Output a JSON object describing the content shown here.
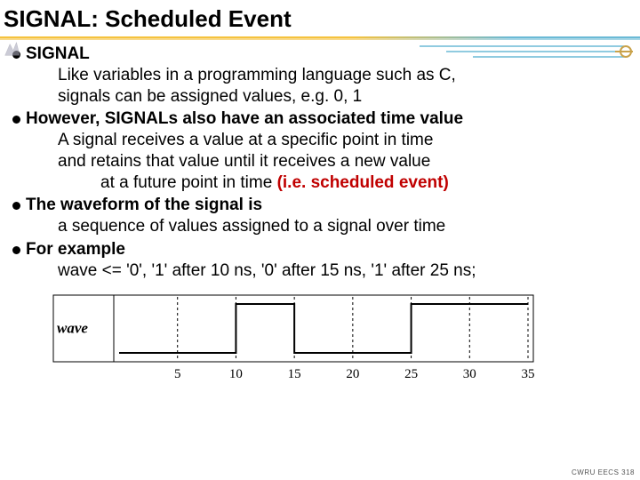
{
  "title": "SIGNAL: Scheduled Event",
  "bullets": [
    {
      "head": "SIGNAL",
      "subs": [
        "Like variables in a programming language such as C,",
        "signals can be assigned values, e.g. 0, 1"
      ]
    },
    {
      "head": "However, SIGNALs also have an associated time value",
      "subs": [
        "A signal receives a value at a specific point in time",
        "and retains that value until it receives a new value"
      ],
      "sub_extra": "at a future point in time ",
      "sub_extra_em": "(i.e. scheduled event)"
    },
    {
      "head": "The waveform of the signal is",
      "subs": [
        "a sequence of values assigned to a signal over time"
      ]
    },
    {
      "head": "For example",
      "subs": [
        "wave <= '0', '1' after 10 ns, '0' after 15 ns, '1' after 25 ns;"
      ]
    }
  ],
  "chart_data": {
    "type": "line",
    "title": "",
    "signal_label": "wave",
    "xlabel": "",
    "ylabel": "",
    "x_ticks": [
      5,
      10,
      15,
      20,
      25,
      30,
      35
    ],
    "ylim": [
      0,
      1
    ],
    "transitions": [
      {
        "time": 0,
        "value": 0
      },
      {
        "time": 10,
        "value": 1
      },
      {
        "time": 15,
        "value": 0
      },
      {
        "time": 25,
        "value": 1
      }
    ],
    "note": "digital waveform; value held between transitions; dashed vertical gridlines at each tick"
  },
  "footer": "CWRU EECS 318"
}
